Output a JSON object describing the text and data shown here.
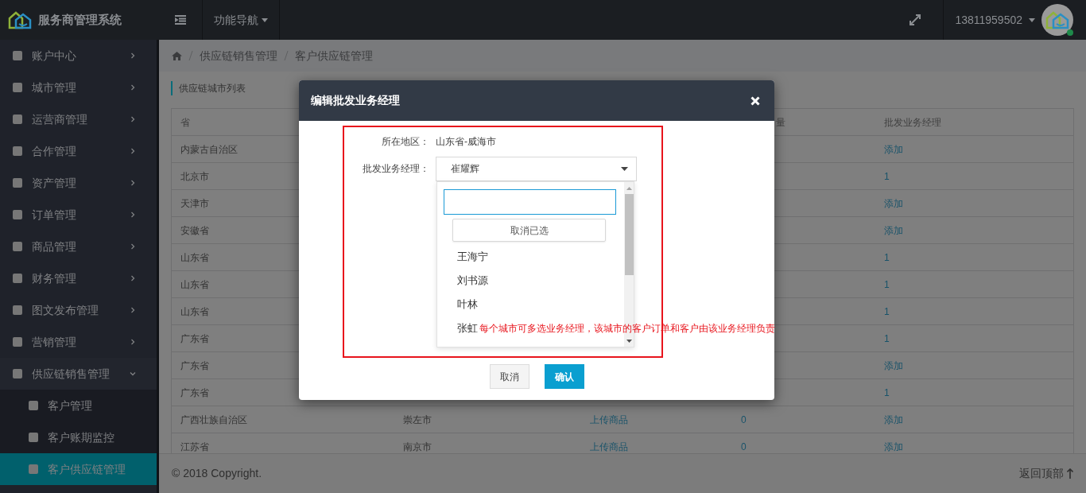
{
  "header": {
    "brand": "服务商管理系统",
    "nav_label": "功能导航",
    "user": "13811959502"
  },
  "sidebar": {
    "items": [
      {
        "label": "账户中心",
        "expanded": false
      },
      {
        "label": "城市管理",
        "expanded": false
      },
      {
        "label": "运营商管理",
        "expanded": false
      },
      {
        "label": "合作管理",
        "expanded": false
      },
      {
        "label": "资产管理",
        "expanded": false
      },
      {
        "label": "订单管理",
        "expanded": false
      },
      {
        "label": "商品管理",
        "expanded": false
      },
      {
        "label": "财务管理",
        "expanded": false
      },
      {
        "label": "图文发布管理",
        "expanded": false
      },
      {
        "label": "营销管理",
        "expanded": false
      },
      {
        "label": "供应链销售管理",
        "expanded": true,
        "children": [
          {
            "label": "客户管理",
            "selected": false
          },
          {
            "label": "客户账期监控",
            "selected": false
          },
          {
            "label": "客户供应链管理",
            "selected": true
          }
        ]
      }
    ]
  },
  "breadcrumb": [
    "供应链销售管理",
    "客户供应链管理"
  ],
  "section_title": "供应链城市列表",
  "table": {
    "headers": {
      "column_1": "省",
      "column_4": "量",
      "column_5": "批发业务经理"
    },
    "rows": [
      {
        "column_1": "内蒙古自治区",
        "column_5": "添加"
      },
      {
        "column_1": "北京市",
        "column_5": "1"
      },
      {
        "column_1": "天津市",
        "column_5": "添加"
      },
      {
        "column_1": "安徽省",
        "column_5": "添加"
      },
      {
        "column_1": "山东省",
        "column_5": "1"
      },
      {
        "column_1": "山东省",
        "column_5": "1"
      },
      {
        "column_1": "山东省",
        "column_5": "1"
      },
      {
        "column_1": "广东省",
        "column_5": "1"
      },
      {
        "column_1": "广东省",
        "column_5": "添加"
      },
      {
        "column_1": "广东省",
        "column_5": "1"
      },
      {
        "column_1": "广西壮族自治区",
        "column_2": "崇左市",
        "column_3": "上传商品",
        "column_4": "0",
        "column_5": "添加"
      },
      {
        "column_1": "江苏省",
        "column_2": "南京市",
        "column_3": "上传商品",
        "column_4": "0",
        "column_5": "添加"
      }
    ]
  },
  "modal": {
    "title": "编辑批发业务经理",
    "fields": [
      {
        "kind": "text",
        "label": "所在地区：",
        "value": "山东省-威海市"
      },
      {
        "kind": "select",
        "label": "批发业务经理：",
        "value": "崔耀辉"
      }
    ],
    "dropdown": {
      "clear_button": "取消已选",
      "options": [
        "王海宁",
        "刘书源",
        "叶林",
        "张虹"
      ]
    },
    "hint": "每个城市可多选业务经理，该城市的客户订单和客户由该业务经理负责",
    "buttons": [
      {
        "label": "取消",
        "kind": "secondary"
      },
      {
        "label": "确认",
        "kind": "primary"
      }
    ]
  },
  "footer": {
    "copyright": "© 2018 Copyright.",
    "back_to_top": "返回顶部"
  }
}
